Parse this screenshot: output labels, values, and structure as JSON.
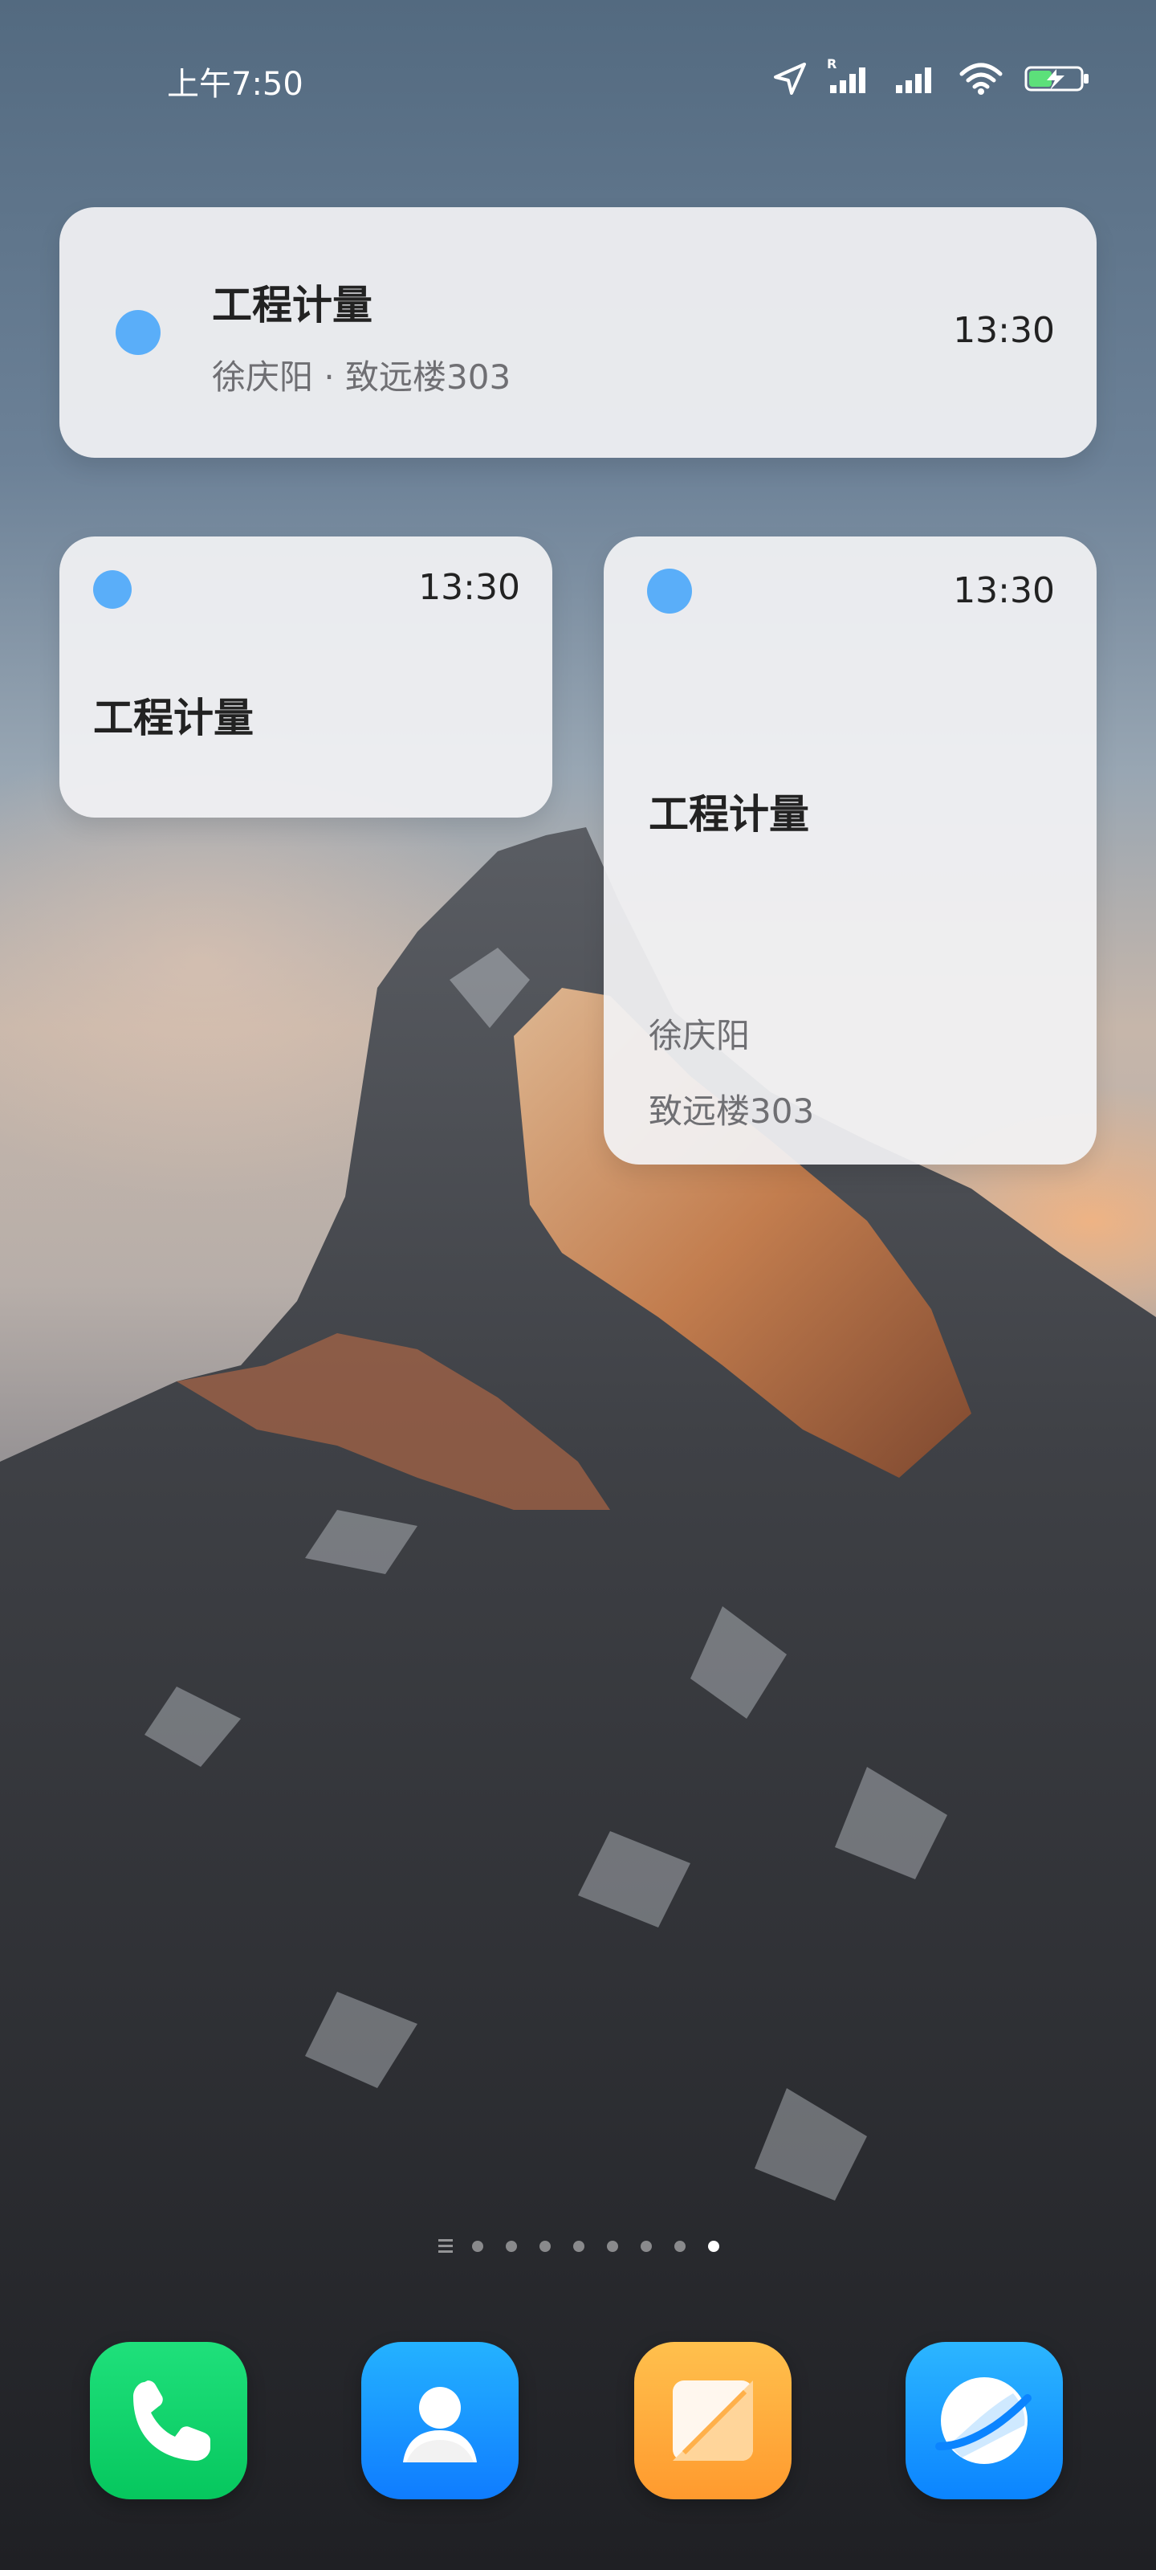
{
  "status_bar": {
    "time": "上午7:50",
    "icons": [
      "location-icon",
      "signal-roaming-icon",
      "signal-icon",
      "wifi-icon",
      "battery-charging-icon"
    ],
    "signal_roaming_marker": "R"
  },
  "widgets": {
    "wide": {
      "title": "工程计量",
      "subtitle": "徐庆阳 · 致远楼303",
      "time": "13:30",
      "dot_color": "#5aaef9"
    },
    "small": {
      "title": "工程计量",
      "time": "13:30",
      "dot_color": "#5aaef9"
    },
    "tall": {
      "title": "工程计量",
      "teacher": "徐庆阳",
      "room": "致远楼303",
      "time": "13:30",
      "dot_color": "#5aaef9"
    }
  },
  "page_indicator": {
    "pages": 8,
    "active_page": 8
  },
  "dock": {
    "apps": [
      "phone-icon",
      "contacts-icon",
      "notes-icon",
      "browser-icon"
    ],
    "colors": {
      "phone": "#0ad66b",
      "contacts": "#1c8bff",
      "notes": "#ffae35",
      "browser": "#1f9bff"
    }
  }
}
